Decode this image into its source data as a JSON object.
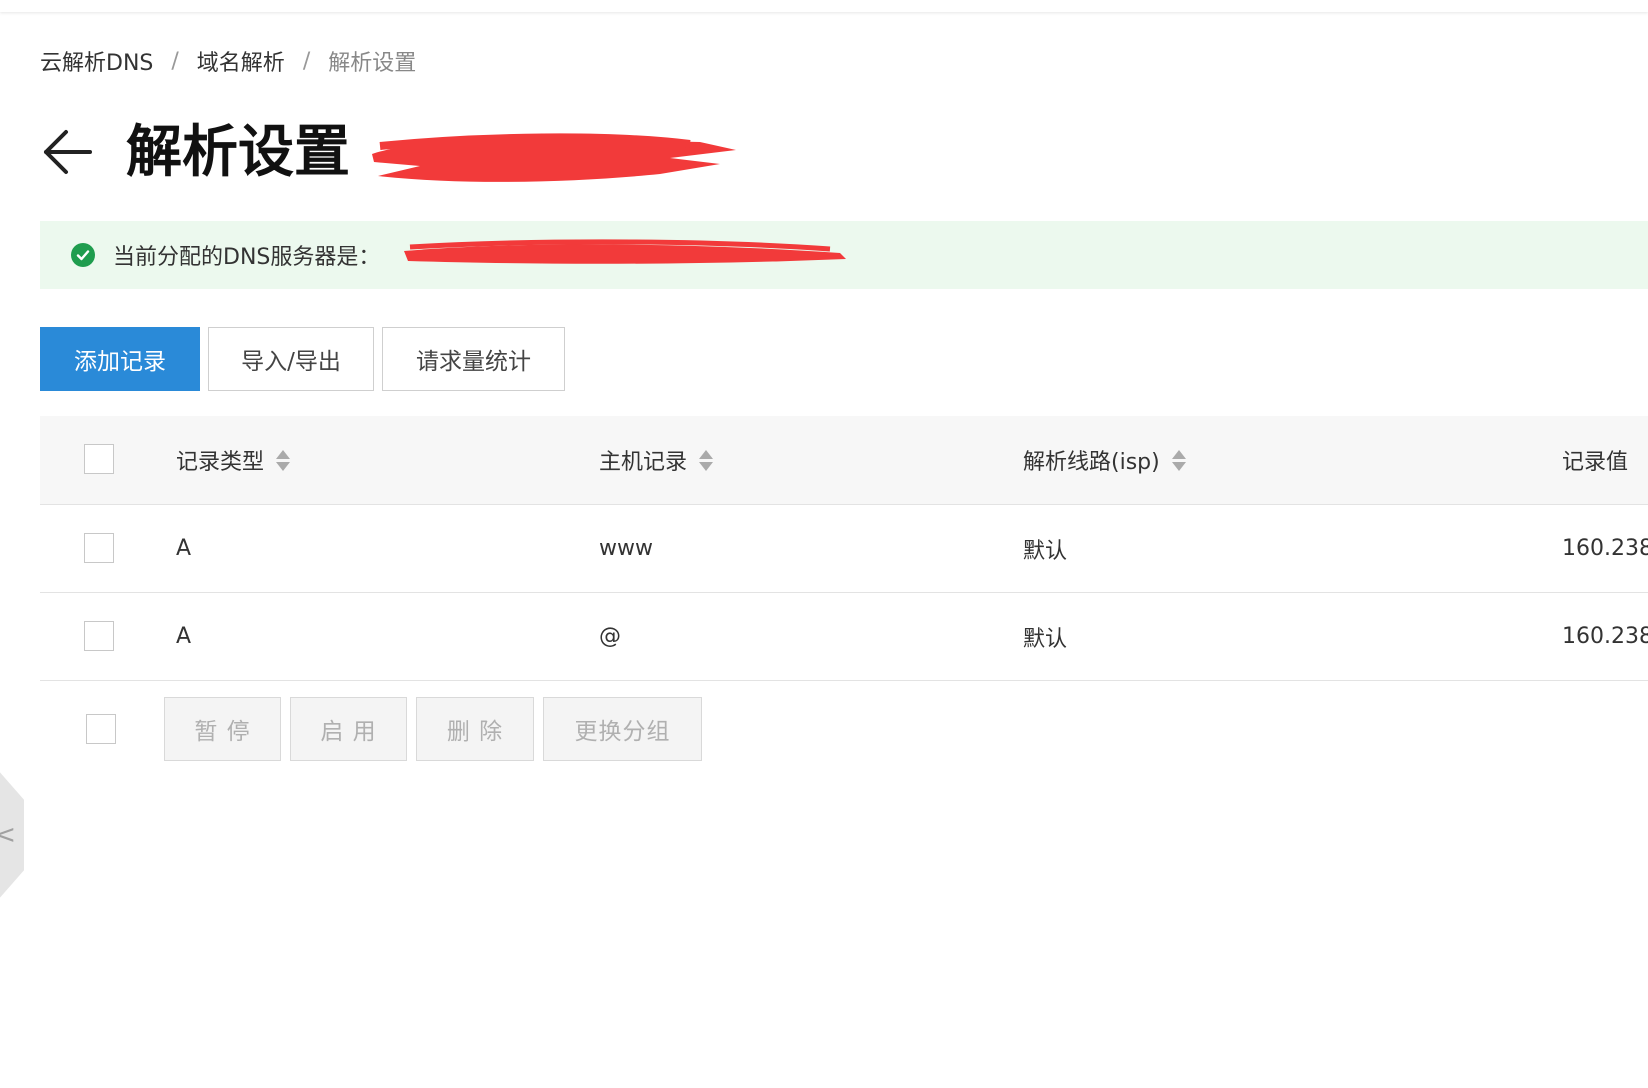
{
  "breadcrumb": {
    "items": [
      "云解析DNS",
      "域名解析",
      "解析设置"
    ],
    "separator": "/"
  },
  "page": {
    "title": "解析设置"
  },
  "alert": {
    "message": "当前分配的DNS服务器是：",
    "status_color": "#1f9d4e",
    "background": "#ecf9ee"
  },
  "toolbar": {
    "add_label": "添加记录",
    "import_export_label": "导入/导出",
    "stats_label": "请求量统计",
    "primary_color": "#2a8ad8"
  },
  "table": {
    "columns": [
      "记录类型",
      "主机记录",
      "解析线路(isp)",
      "记录值"
    ],
    "rows": [
      {
        "type": "A",
        "host": "www",
        "line": "默认",
        "value": "160.238"
      },
      {
        "type": "A",
        "host": "@",
        "line": "默认",
        "value": "160.238"
      }
    ]
  },
  "batch": {
    "pause_label": "暂 停",
    "enable_label": "启 用",
    "delete_label": "删 除",
    "change_group_label": "更换分组"
  },
  "sidebar": {
    "collapse_glyph": "<"
  },
  "redaction_color": "#f23a3a",
  "icons": [
    "back-arrow-icon",
    "check-circle-icon",
    "sort-icon",
    "chevron-left-icon"
  ]
}
